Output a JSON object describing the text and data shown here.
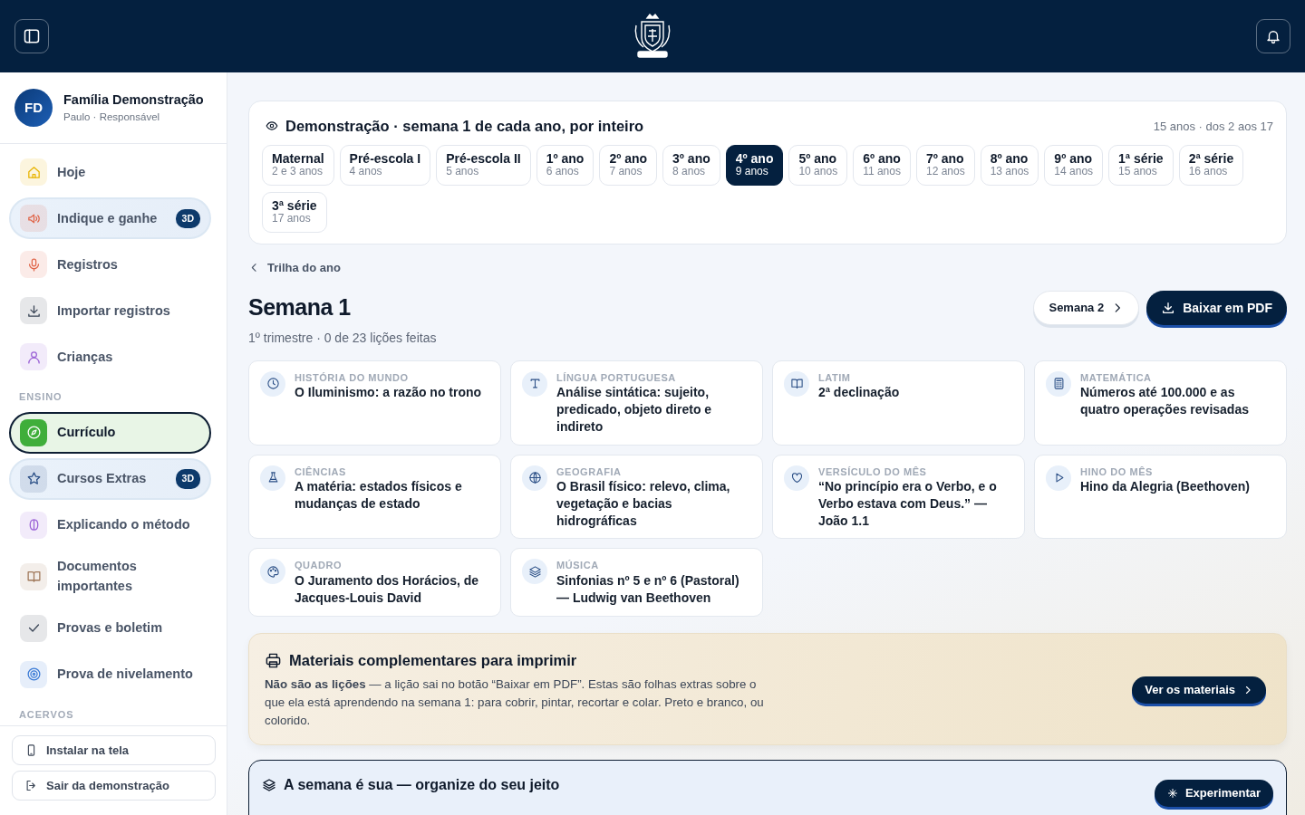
{
  "profile": {
    "initials": "FD",
    "name": "Família Demonstração",
    "role": "Paulo · Responsável"
  },
  "sidebar": {
    "items": [
      {
        "kind": "item",
        "label": "Hoje",
        "selected": false,
        "featured": false
      },
      {
        "kind": "item",
        "label": "Indique e ganhe",
        "selected": false,
        "featured": true,
        "badge": "3D"
      },
      {
        "kind": "item",
        "label": "Registros",
        "selected": false,
        "featured": false
      },
      {
        "kind": "item",
        "label": "Importar registros",
        "selected": false,
        "featured": false
      },
      {
        "kind": "item",
        "label": "Crianças",
        "selected": false,
        "featured": false
      },
      {
        "kind": "section",
        "label": "ENSINO"
      },
      {
        "kind": "item",
        "label": "Currículo",
        "selected": true,
        "featured": false
      },
      {
        "kind": "item",
        "label": "Cursos Extras",
        "selected": false,
        "featured": true,
        "badge": "3D"
      },
      {
        "kind": "item",
        "label": "Explicando o método",
        "selected": false,
        "featured": false
      },
      {
        "kind": "item",
        "label": "Documentos importantes",
        "selected": false,
        "featured": false
      },
      {
        "kind": "item",
        "label": "Provas e boletim",
        "selected": false,
        "featured": false
      },
      {
        "kind": "item",
        "label": "Prova de nivelamento",
        "selected": false,
        "featured": false
      },
      {
        "kind": "section",
        "label": "ACERVOS"
      }
    ],
    "footer": [
      "Instalar na tela",
      "Sair da demonstração"
    ]
  },
  "demo": {
    "title": "Demonstração · semana 1 de cada ano, por inteiro",
    "meta": "15 anos · dos 2 aos 17",
    "grades": [
      {
        "name": "Maternal",
        "age": "2 e 3 anos",
        "selected": false
      },
      {
        "name": "Pré-escola I",
        "age": "4 anos",
        "selected": false
      },
      {
        "name": "Pré-escola II",
        "age": "5 anos",
        "selected": false
      },
      {
        "name": "1º ano",
        "age": "6 anos",
        "selected": false
      },
      {
        "name": "2º ano",
        "age": "7 anos",
        "selected": false
      },
      {
        "name": "3º ano",
        "age": "8 anos",
        "selected": false
      },
      {
        "name": "4º ano",
        "age": "9 anos",
        "selected": true
      },
      {
        "name": "5º ano",
        "age": "10 anos",
        "selected": false
      },
      {
        "name": "6º ano",
        "age": "11 anos",
        "selected": false
      },
      {
        "name": "7º ano",
        "age": "12 anos",
        "selected": false
      },
      {
        "name": "8º ano",
        "age": "13 anos",
        "selected": false
      },
      {
        "name": "9º ano",
        "age": "14 anos",
        "selected": false
      },
      {
        "name": "1ª série",
        "age": "15 anos",
        "selected": false
      },
      {
        "name": "2ª série",
        "age": "16 anos",
        "selected": false
      },
      {
        "name": "3ª série",
        "age": "17 anos",
        "selected": false
      }
    ]
  },
  "back_link": "Trilha do ano",
  "week": {
    "title": "Semana 1",
    "subtitle": "1º trimestre · 0 de 23 lições feitas",
    "next_button": "Semana 2",
    "pdf_button": "Baixar em PDF"
  },
  "lessons": [
    {
      "subject": "HISTÓRIA DO MUNDO",
      "title": "O Iluminismo: a razão no trono"
    },
    {
      "subject": "LÍNGUA PORTUGUESA",
      "title": "Análise sintática: sujeito, predicado, objeto direto e indireto"
    },
    {
      "subject": "LATIM",
      "title": "2ª declinação"
    },
    {
      "subject": "MATEMÁTICA",
      "title": "Números até 100.000 e as quatro operações revisadas"
    },
    {
      "subject": "CIÊNCIAS",
      "title": "A matéria: estados físicos e mudanças de estado"
    },
    {
      "subject": "GEOGRAFIA",
      "title": "O Brasil físico: relevo, clima, vegetação e bacias hidrográficas"
    },
    {
      "subject": "VERSÍCULO DO MÊS",
      "title": "“No princípio era o Verbo, e o Verbo estava com Deus.” — João 1.1"
    },
    {
      "subject": "HINO DO MÊS",
      "title": "Hino da Alegria (Beethoven)"
    },
    {
      "subject": "QUADRO",
      "title": "O Juramento dos Horácios, de Jacques-Louis David"
    },
    {
      "subject": "MÚSICA",
      "title": "Sinfonias nº 5 e nº 6 (Pastoral) — Ludwig van Beethoven"
    }
  ],
  "materials": {
    "title": "Materiais complementares para imprimir",
    "text": "**Não são as lições** — a lição sai no botão “Baixar em PDF”. Estas são folhas extras sobre o que ela está aprendendo na semana 1: para cobrir, pintar, recortar e colar. Preto e branco, ou colorido.",
    "button": "Ver os materiais"
  },
  "organize": {
    "title": "A semana é sua — organize do seu jeito",
    "button": "Experimentar"
  }
}
